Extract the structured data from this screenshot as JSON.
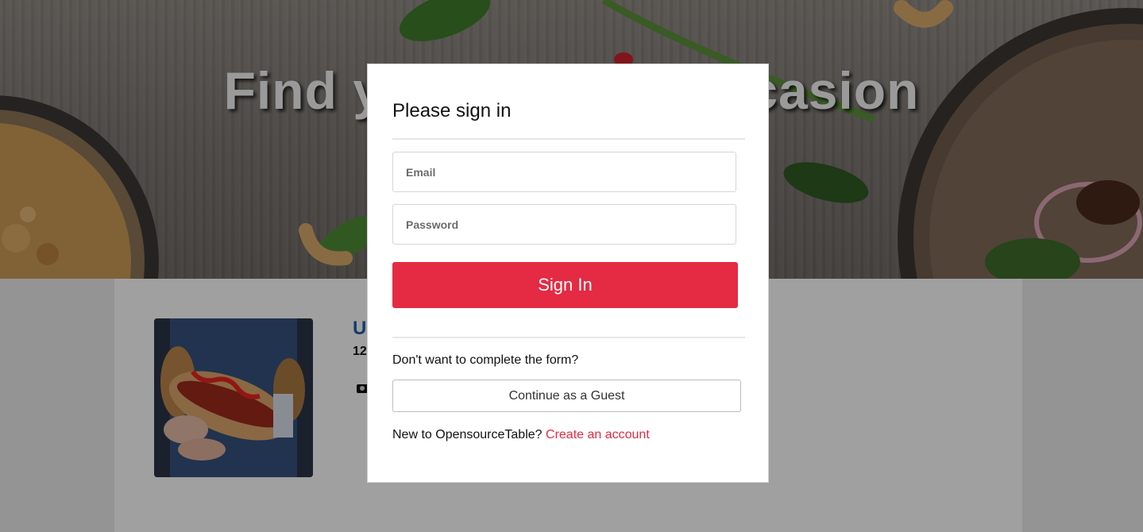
{
  "hero": {
    "title_left": "Find you",
    "title_right": "ccasion"
  },
  "restaurant": {
    "name_partial": "U",
    "meta_partial": "12"
  },
  "signin_modal": {
    "title": "Please sign in",
    "email_placeholder": "Email",
    "email_value": "",
    "password_placeholder": "Password",
    "password_value": "",
    "signin_label": "Sign In",
    "guest_prompt": "Don't want to complete the form?",
    "guest_label": "Continue as a Guest",
    "new_prompt": "New to OpensourceTable?",
    "create_link": "Create an account"
  },
  "colors": {
    "accent": "#e52a43",
    "link_blue": "#1f5fa8",
    "overlay": "rgba(0,0,0,0.36)"
  },
  "icons": {
    "price": "money-icon"
  }
}
